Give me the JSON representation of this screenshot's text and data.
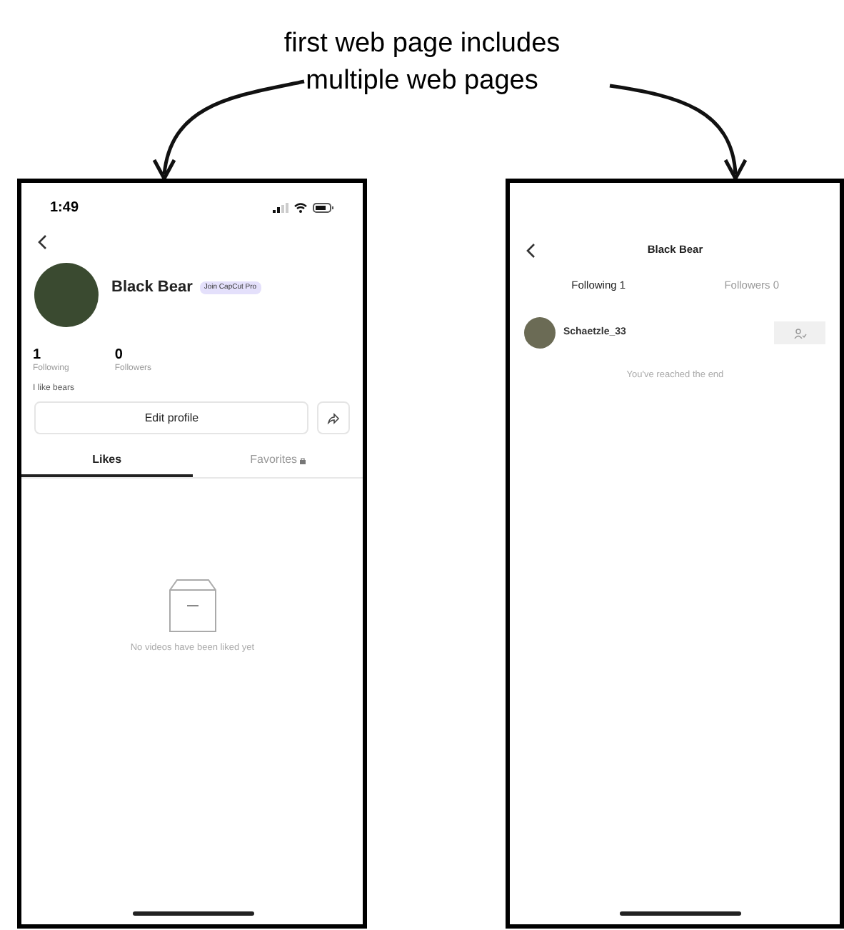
{
  "caption": [
    "first web page includes",
    "multiple web pages"
  ],
  "profile_screen": {
    "status_time": "1:49",
    "name": "Black Bear",
    "badge": "Join CapCut Pro",
    "stats": [
      {
        "value": "1",
        "label": "Following"
      },
      {
        "value": "0",
        "label": "Followers"
      }
    ],
    "bio": "I like bears",
    "edit_button": "Edit profile",
    "tabs": [
      {
        "label": "Likes",
        "selected": true
      },
      {
        "label": "Favorites",
        "selected": false
      }
    ],
    "empty_message": "No videos have been liked yet"
  },
  "follow_screen": {
    "title": "Black Bear",
    "tabs": [
      {
        "label": "Following 1",
        "selected": true
      },
      {
        "label": "Followers 0",
        "selected": false
      }
    ],
    "users": [
      {
        "name": "Schaetzle_33"
      }
    ],
    "end_message": "You've reached the end"
  }
}
